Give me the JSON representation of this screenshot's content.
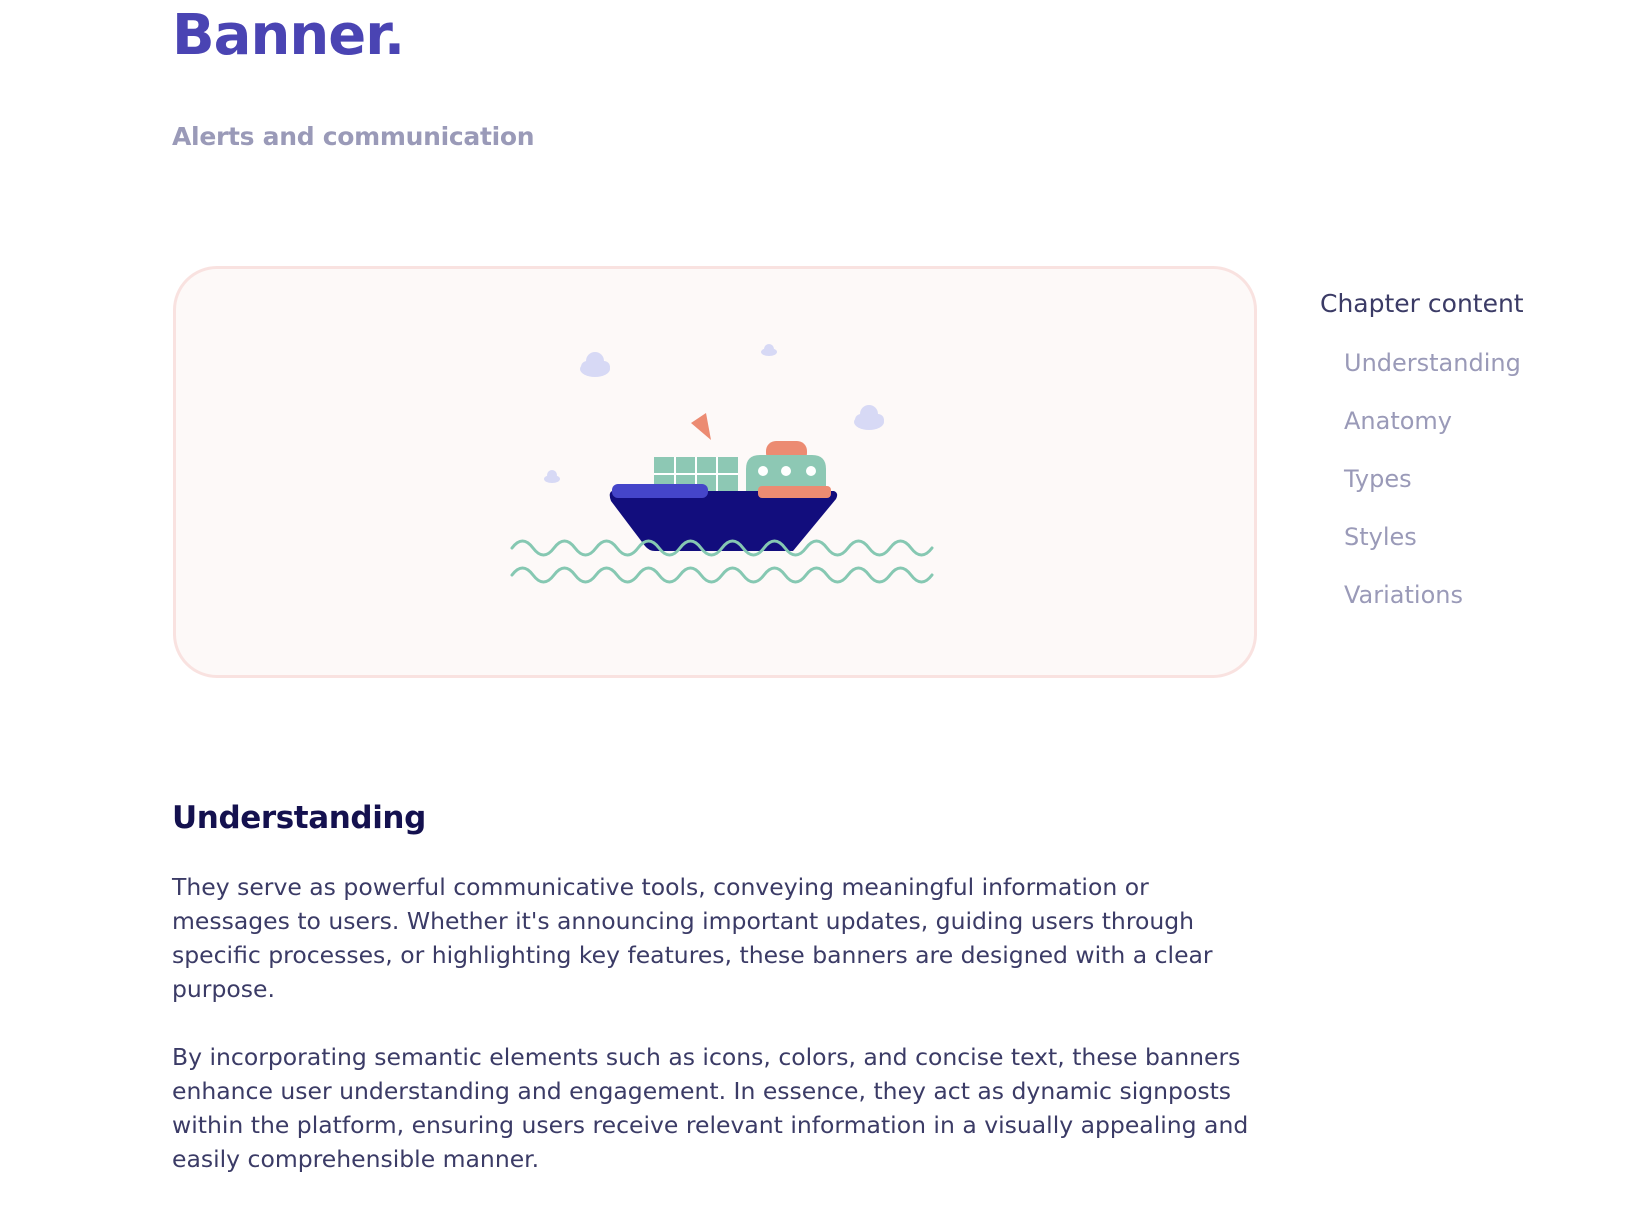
{
  "page": {
    "title": "Banner.",
    "subtitle": "Alerts and communication"
  },
  "hero": {
    "illustration": "cargo-ship-illustration",
    "colors": {
      "background": "#fdf9f8",
      "border": "#f9e2e0",
      "hull": "#120d7d",
      "deck": "#4545c9",
      "containers": "#8dc8b4",
      "accent": "#ec8b72",
      "clouds": "#d7d9f5",
      "waves": "#86c8b2"
    }
  },
  "toc": {
    "heading": "Chapter content",
    "items": [
      {
        "label": "Understanding"
      },
      {
        "label": "Anatomy"
      },
      {
        "label": "Types"
      },
      {
        "label": "Styles"
      },
      {
        "label": "Variations"
      }
    ]
  },
  "section": {
    "heading": "Understanding",
    "paragraphs": [
      "They serve as powerful communicative tools, conveying meaningful information or messages to users. Whether it's announcing important updates, guiding users through specific processes, or highlighting key features, these banners are designed with a clear purpose.",
      "By incorporating semantic elements such as icons, colors, and concise text, these banners enhance user understanding and engagement. In essence, they act as dynamic signposts within the platform, ensuring users receive relevant information in a visually appealing and easily comprehensible manner."
    ]
  },
  "theme": {
    "title_color": "#4a44b3",
    "subtitle_color": "#9a9ab8",
    "heading_color": "#14114f",
    "body_color": "#3b3b66"
  }
}
